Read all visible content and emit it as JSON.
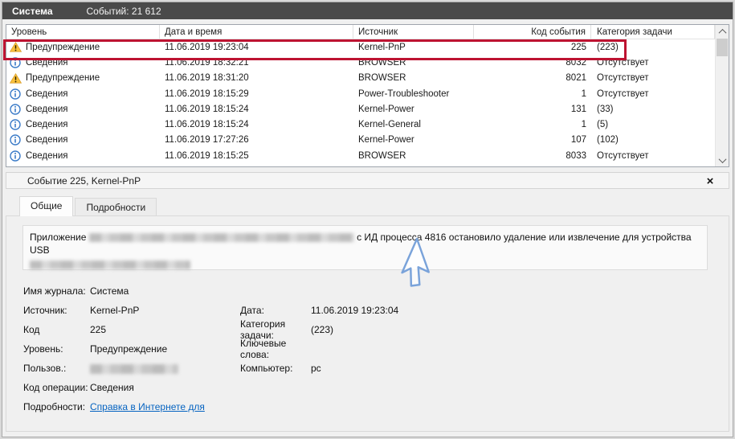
{
  "window": {
    "title": "Система",
    "events_count": "Событий: 21 612"
  },
  "table": {
    "columns": [
      "Уровень",
      "Дата и время",
      "Источник",
      "Код события",
      "Категория задачи"
    ],
    "rows": [
      {
        "icon": "warning",
        "level": "Предупреждение",
        "datetime": "11.06.2019 19:23:04",
        "source": "Kernel-PnP",
        "event_id": "225",
        "category": "(223)",
        "highlighted": true
      },
      {
        "icon": "info",
        "level": "Сведения",
        "datetime": "11.06.2019 18:32:21",
        "source": "BROWSER",
        "event_id": "8032",
        "category": "Отсутствует",
        "highlighted": false
      },
      {
        "icon": "warning",
        "level": "Предупреждение",
        "datetime": "11.06.2019 18:31:20",
        "source": "BROWSER",
        "event_id": "8021",
        "category": "Отсутствует",
        "highlighted": false
      },
      {
        "icon": "info",
        "level": "Сведения",
        "datetime": "11.06.2019 18:15:29",
        "source": "Power-Troubleshooter",
        "event_id": "1",
        "category": "Отсутствует",
        "highlighted": false
      },
      {
        "icon": "info",
        "level": "Сведения",
        "datetime": "11.06.2019 18:15:24",
        "source": "Kernel-Power",
        "event_id": "131",
        "category": "(33)",
        "highlighted": false
      },
      {
        "icon": "info",
        "level": "Сведения",
        "datetime": "11.06.2019 18:15:24",
        "source": "Kernel-General",
        "event_id": "1",
        "category": "(5)",
        "highlighted": false
      },
      {
        "icon": "info",
        "level": "Сведения",
        "datetime": "11.06.2019 17:27:26",
        "source": "Kernel-Power",
        "event_id": "107",
        "category": "(102)",
        "highlighted": false
      },
      {
        "icon": "info",
        "level": "Сведения",
        "datetime": "11.06.2019 18:15:25",
        "source": "BROWSER",
        "event_id": "8033",
        "category": "Отсутствует",
        "highlighted": false
      }
    ]
  },
  "details": {
    "header": "Событие 225, Kernel-PnP",
    "close_label": "×",
    "tabs": [
      {
        "label": "Общие"
      },
      {
        "label": "Подробности"
      }
    ],
    "description": {
      "part1": "Приложение",
      "part2": "с ИД процесса 4816 остановило удаление или извлечение для устройства USB"
    },
    "fields": {
      "log_name_label": "Имя журнала:",
      "log_name": "Система",
      "source_label": "Источник:",
      "source": "Kernel-PnP",
      "date_label": "Дата:",
      "date": "11.06.2019 19:23:04",
      "code_label": "Код",
      "code": "225",
      "category_label": "Категория задачи:",
      "category": "(223)",
      "level_label": "Уровень:",
      "level": "Предупреждение",
      "keywords_label": "Ключевые слова:",
      "keywords": "",
      "user_label": "Пользов.:",
      "computer_label": "Компьютер:",
      "computer": "pc",
      "opcode_label": "Код операции:",
      "opcode": "Сведения",
      "more_label": "Подробности:",
      "more_link": "Справка в Интернете для"
    }
  },
  "colors": {
    "topbar_bg": "#4a4a4a",
    "highlight_red": "#bd1331",
    "link_blue": "#0563c1",
    "warning_yellow": "#f9c13c",
    "info_blue": "#3b7bc8",
    "cursor_blue": "#7aa3da"
  }
}
